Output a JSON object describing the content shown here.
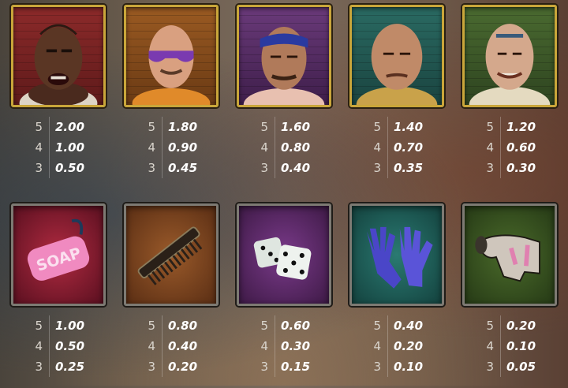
{
  "paytable": {
    "top_row": [
      {
        "symbol": "prisoner-tattooed-man-icon",
        "pays": [
          {
            "count": "5",
            "value": "2.00"
          },
          {
            "count": "4",
            "value": "1.00"
          },
          {
            "count": "3",
            "value": "0.50"
          }
        ]
      },
      {
        "symbol": "prisoner-sunglasses-man-icon",
        "pays": [
          {
            "count": "5",
            "value": "1.80"
          },
          {
            "count": "4",
            "value": "0.90"
          },
          {
            "count": "3",
            "value": "0.45"
          }
        ]
      },
      {
        "symbol": "prisoner-bandana-man-icon",
        "pays": [
          {
            "count": "5",
            "value": "1.60"
          },
          {
            "count": "4",
            "value": "0.80"
          },
          {
            "count": "3",
            "value": "0.40"
          }
        ]
      },
      {
        "symbol": "prisoner-bald-man-icon",
        "pays": [
          {
            "count": "5",
            "value": "1.40"
          },
          {
            "count": "4",
            "value": "0.70"
          },
          {
            "count": "3",
            "value": "0.35"
          }
        ]
      },
      {
        "symbol": "prisoner-forehead-tattoo-man-icon",
        "pays": [
          {
            "count": "5",
            "value": "1.20"
          },
          {
            "count": "4",
            "value": "0.60"
          },
          {
            "count": "3",
            "value": "0.30"
          }
        ]
      }
    ],
    "bottom_row": [
      {
        "symbol": "soap-on-rope-icon",
        "label": "SOAP",
        "pays": [
          {
            "count": "5",
            "value": "1.00"
          },
          {
            "count": "4",
            "value": "0.50"
          },
          {
            "count": "3",
            "value": "0.25"
          }
        ]
      },
      {
        "symbol": "comb-icon",
        "pays": [
          {
            "count": "5",
            "value": "0.80"
          },
          {
            "count": "4",
            "value": "0.40"
          },
          {
            "count": "3",
            "value": "0.20"
          }
        ]
      },
      {
        "symbol": "dice-icon",
        "pays": [
          {
            "count": "5",
            "value": "0.60"
          },
          {
            "count": "4",
            "value": "0.30"
          },
          {
            "count": "3",
            "value": "0.15"
          }
        ]
      },
      {
        "symbol": "rubber-gloves-icon",
        "pays": [
          {
            "count": "5",
            "value": "0.40"
          },
          {
            "count": "4",
            "value": "0.20"
          },
          {
            "count": "3",
            "value": "0.10"
          }
        ]
      },
      {
        "symbol": "sock-icon",
        "pays": [
          {
            "count": "5",
            "value": "0.20"
          },
          {
            "count": "4",
            "value": "0.10"
          },
          {
            "count": "3",
            "value": "0.05"
          }
        ]
      }
    ]
  },
  "colors": {
    "gold_frame": "#c9a63a",
    "gray_frame": "#7d7a73",
    "tile_red": "#7a1c22",
    "tile_orange": "#8a4a1c",
    "tile_purple": "#5a2a5e",
    "tile_teal": "#1f5a58",
    "tile_green": "#3c5a26"
  }
}
